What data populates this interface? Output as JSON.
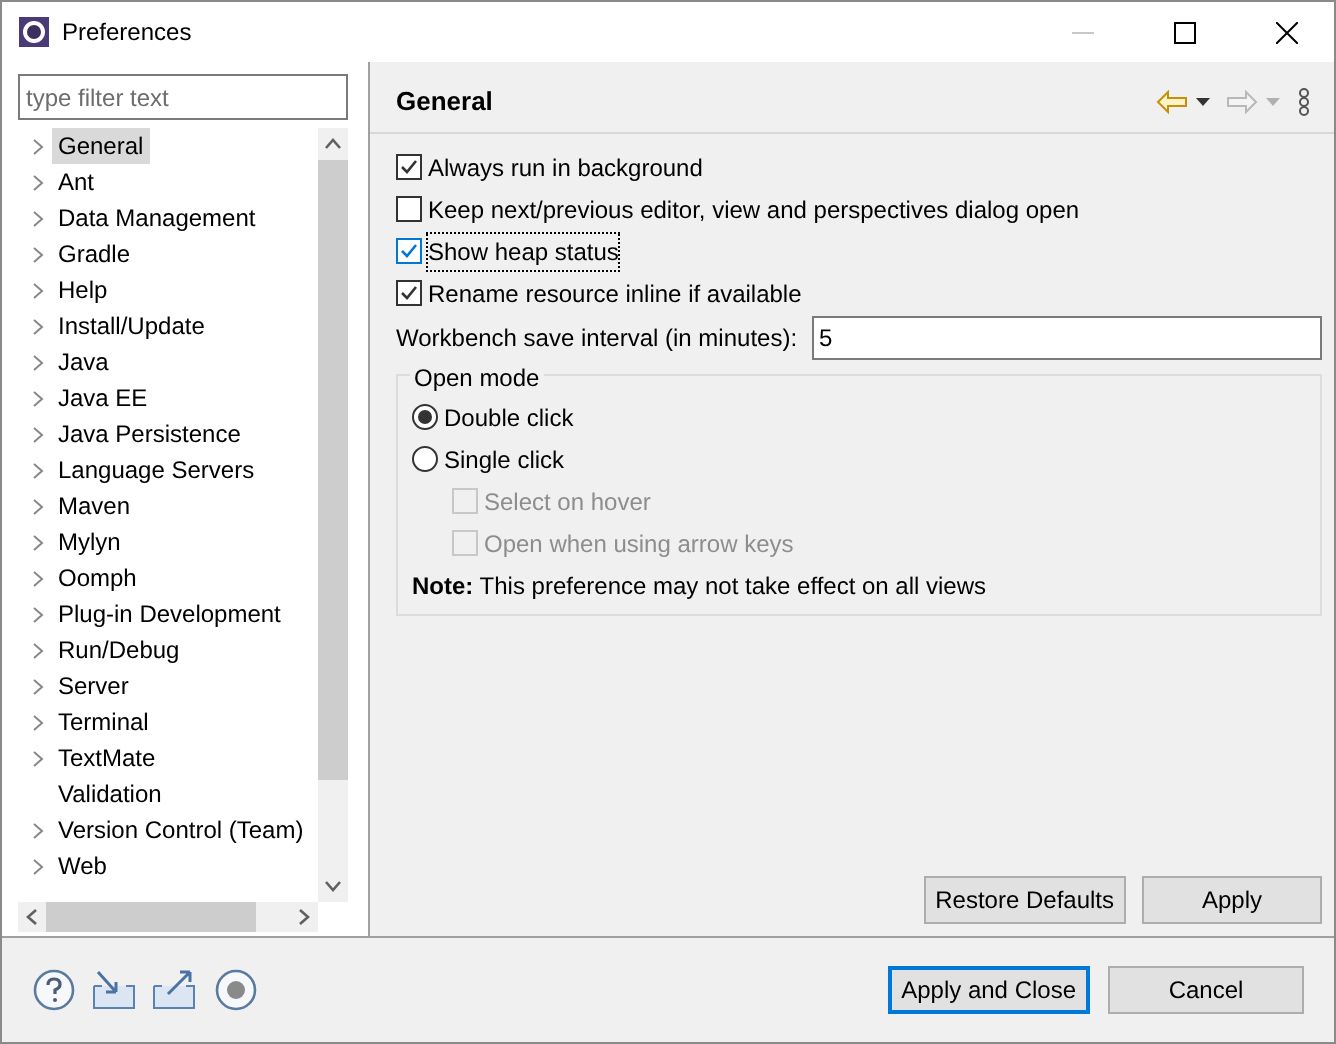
{
  "window": {
    "title": "Preferences"
  },
  "filter": {
    "placeholder": "type filter text"
  },
  "tree": [
    {
      "label": "General",
      "selected": true,
      "expandable": true
    },
    {
      "label": "Ant",
      "selected": false,
      "expandable": true
    },
    {
      "label": "Data Management",
      "selected": false,
      "expandable": true
    },
    {
      "label": "Gradle",
      "selected": false,
      "expandable": true
    },
    {
      "label": "Help",
      "selected": false,
      "expandable": true
    },
    {
      "label": "Install/Update",
      "selected": false,
      "expandable": true
    },
    {
      "label": "Java",
      "selected": false,
      "expandable": true
    },
    {
      "label": "Java EE",
      "selected": false,
      "expandable": true
    },
    {
      "label": "Java Persistence",
      "selected": false,
      "expandable": true
    },
    {
      "label": "Language Servers",
      "selected": false,
      "expandable": true
    },
    {
      "label": "Maven",
      "selected": false,
      "expandable": true
    },
    {
      "label": "Mylyn",
      "selected": false,
      "expandable": true
    },
    {
      "label": "Oomph",
      "selected": false,
      "expandable": true
    },
    {
      "label": "Plug-in Development",
      "selected": false,
      "expandable": true
    },
    {
      "label": "Run/Debug",
      "selected": false,
      "expandable": true
    },
    {
      "label": "Server",
      "selected": false,
      "expandable": true
    },
    {
      "label": "Terminal",
      "selected": false,
      "expandable": true
    },
    {
      "label": "TextMate",
      "selected": false,
      "expandable": true
    },
    {
      "label": "Validation",
      "selected": false,
      "expandable": false
    },
    {
      "label": "Version Control (Team)",
      "selected": false,
      "expandable": true
    },
    {
      "label": "Web",
      "selected": false,
      "expandable": true
    }
  ],
  "page": {
    "title": "General",
    "back": {
      "disabled": false
    },
    "forward": {
      "disabled": true
    }
  },
  "options": [
    {
      "label": "Always run in background",
      "checked": true,
      "focused": false
    },
    {
      "label": "Keep next/previous editor, view and perspectives dialog open",
      "checked": false,
      "focused": false
    },
    {
      "label": "Show heap status",
      "checked": true,
      "focused": true
    },
    {
      "label": "Rename resource inline if available",
      "checked": true,
      "focused": false
    }
  ],
  "save_interval": {
    "label": "Workbench save interval (in minutes):",
    "value": "5"
  },
  "open_mode": {
    "title": "Open mode",
    "options": [
      {
        "kind": "radio",
        "label": "Double click",
        "selected": true
      },
      {
        "kind": "radio",
        "label": "Single click",
        "selected": false
      },
      {
        "kind": "checkbox",
        "label": "Select on hover",
        "checked": false,
        "disabled": true
      },
      {
        "kind": "checkbox",
        "label": "Open when using arrow keys",
        "checked": false,
        "disabled": true
      }
    ],
    "note": "**Note:** This preference may not take effect on all views"
  },
  "page_buttons": [
    "Restore Defaults",
    "Apply"
  ],
  "dialog_buttons": [
    {
      "label": "Apply and Close",
      "default": true
    },
    {
      "label": "Cancel",
      "default": false
    }
  ]
}
